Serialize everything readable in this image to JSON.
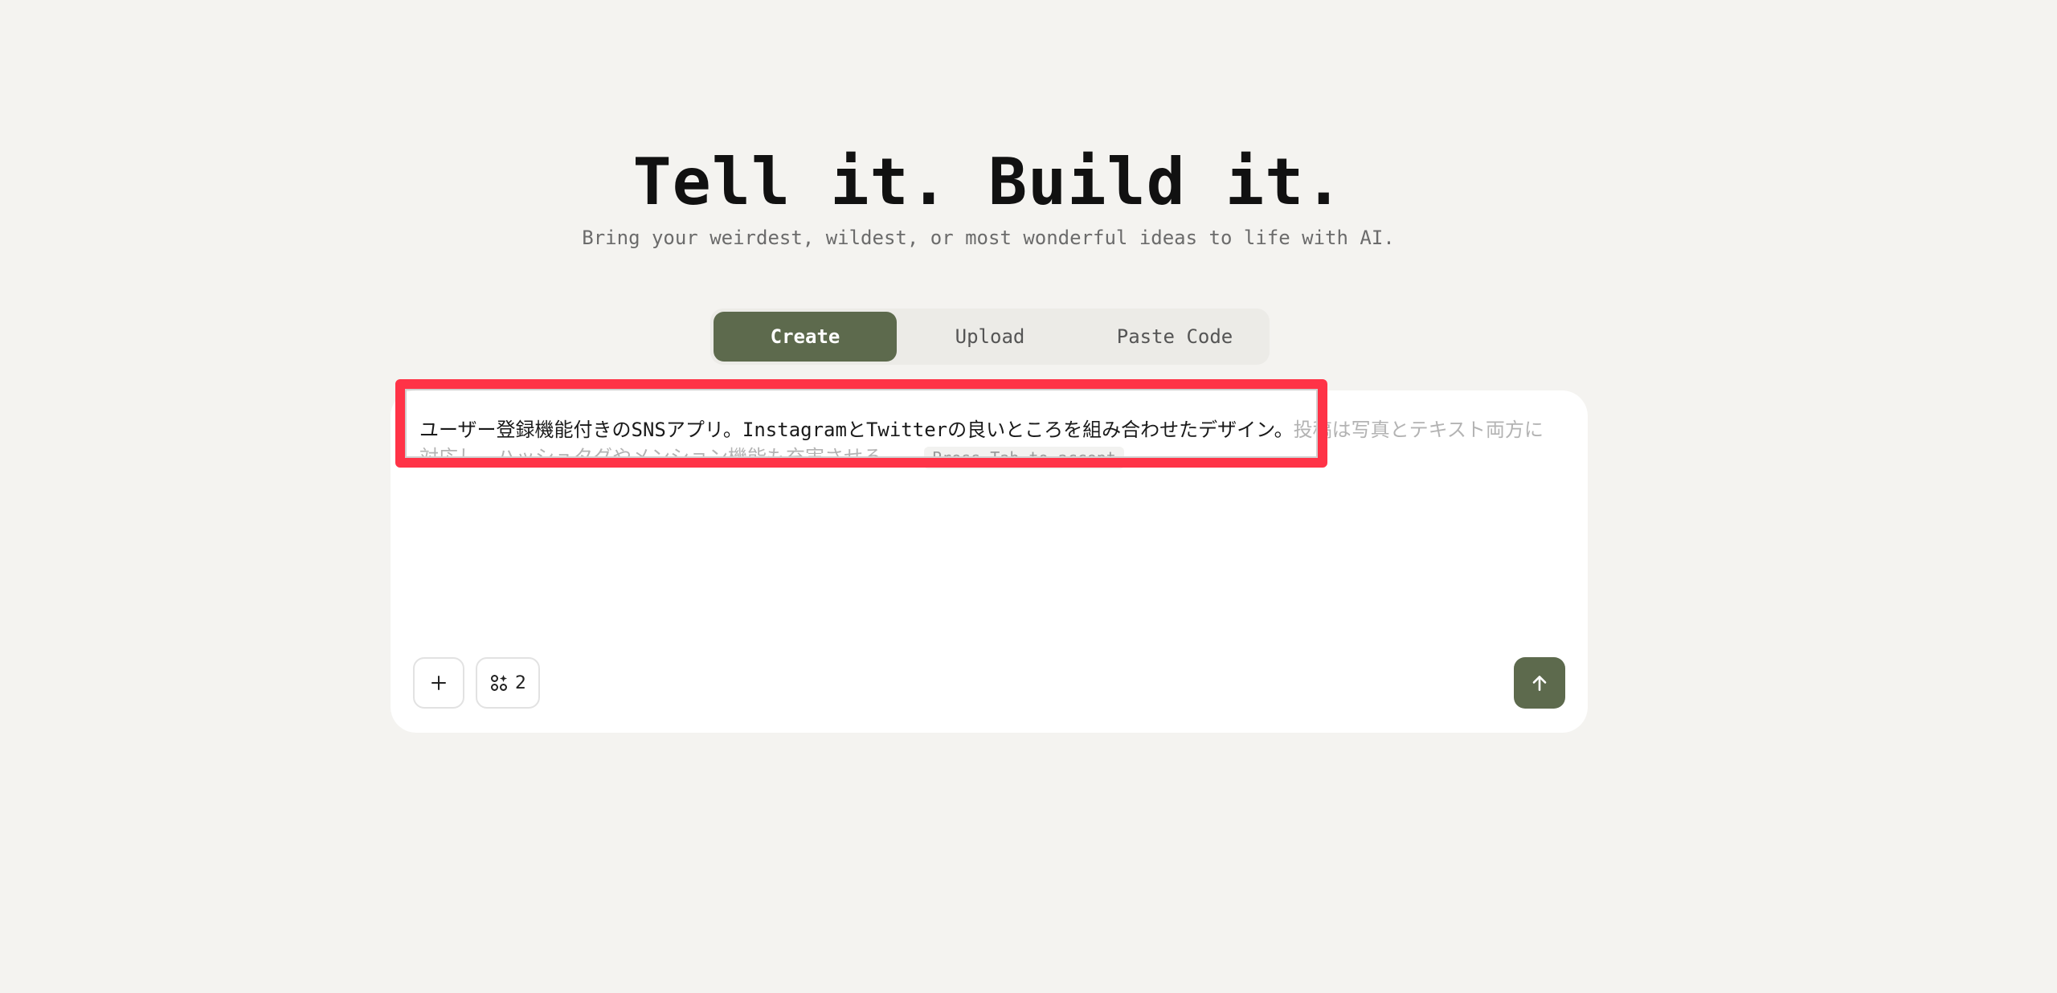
{
  "hero": {
    "title": "Tell it. Build it.",
    "subtitle": "Bring your weirdest, wildest, or most wonderful ideas to life with AI."
  },
  "mode_tabs": [
    {
      "label": "Create",
      "active": true
    },
    {
      "label": "Upload",
      "active": false
    },
    {
      "label": "Paste Code",
      "active": false
    }
  ],
  "composer": {
    "typed_text": "ユーザー登録機能付きのSNSアプリ。InstagramとTwitterの良いところを組み合わせたデザイン。",
    "suggestion_text": "投稿は写真とテキスト両方に対応し、ハッシュタグやメンション機能も充実させる。",
    "tab_hint": "Press Tab to accept",
    "skills_count": "2",
    "attach_icon": "plus-icon",
    "skills_icon": "skills-grid-icon",
    "send_icon": "arrow-up-icon"
  },
  "colors": {
    "accent": "#5d6a4d",
    "background": "#f4f3f0",
    "highlight": "#ff3347"
  }
}
